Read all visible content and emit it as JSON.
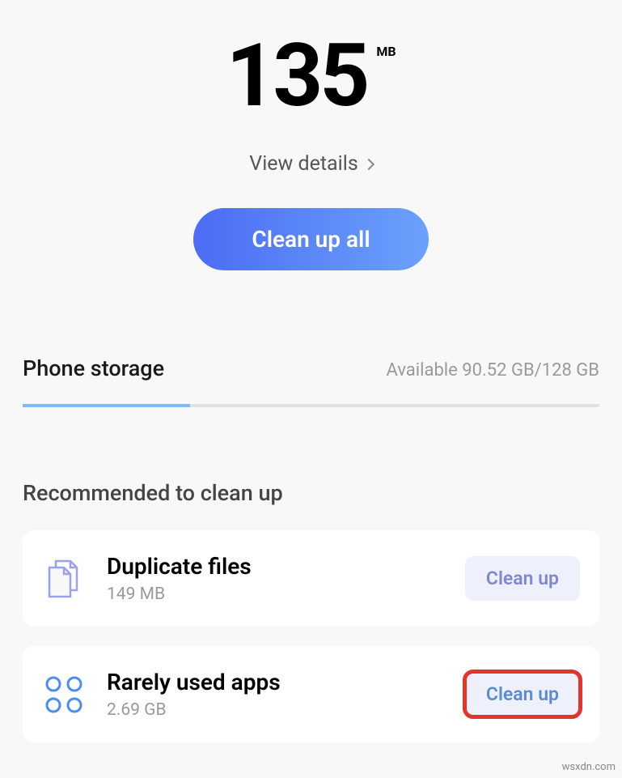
{
  "hero": {
    "size_value": "135",
    "size_unit": "MB",
    "view_details_label": "View details",
    "cleanup_all_label": "Clean up all"
  },
  "storage": {
    "title": "Phone storage",
    "available_text": "Available 90.52 GB/128 GB",
    "used_percent": 29
  },
  "recommend": {
    "title": "Recommended to clean up",
    "items": [
      {
        "icon": "duplicate-files-icon",
        "title": "Duplicate files",
        "subtitle": "149 MB",
        "action_label": "Clean up",
        "highlighted": false
      },
      {
        "icon": "rarely-used-apps-icon",
        "title": "Rarely used apps",
        "subtitle": "2.69 GB",
        "action_label": "Clean up",
        "highlighted": true
      }
    ]
  },
  "watermark": "wsxdn.com"
}
